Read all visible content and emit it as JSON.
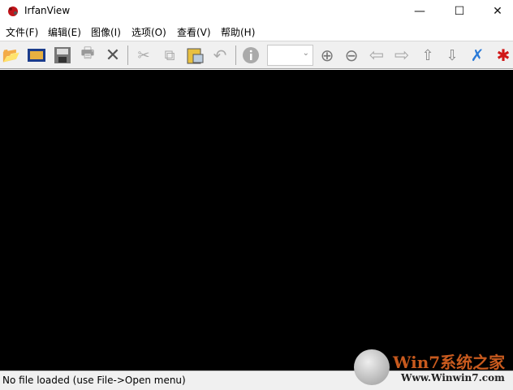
{
  "window": {
    "title": "IrfanView",
    "minimize": "—",
    "maximize": "☐",
    "close": "✕"
  },
  "menu": [
    "文件(F)",
    "编辑(E)",
    "图像(I)",
    "选项(O)",
    "查看(V)",
    "帮助(H)"
  ],
  "toolbar": {
    "icons": [
      "open-folder-icon",
      "slideshow-icon",
      "save-icon",
      "print-icon",
      "delete-icon",
      "cut-icon",
      "copy-icon",
      "paste-icon",
      "undo-icon",
      "info-icon",
      "zoom-in-icon",
      "zoom-out-icon",
      "previous-icon",
      "next-icon",
      "previous-file-icon",
      "next-file-icon",
      "settings-icon",
      "irfanview-logo-icon"
    ],
    "zoom_combo_value": ""
  },
  "status": {
    "text": "No file loaded (use File->Open menu)"
  },
  "watermark": {
    "brand": "Win7系统之家",
    "url": "Www.Winwin7.com"
  }
}
